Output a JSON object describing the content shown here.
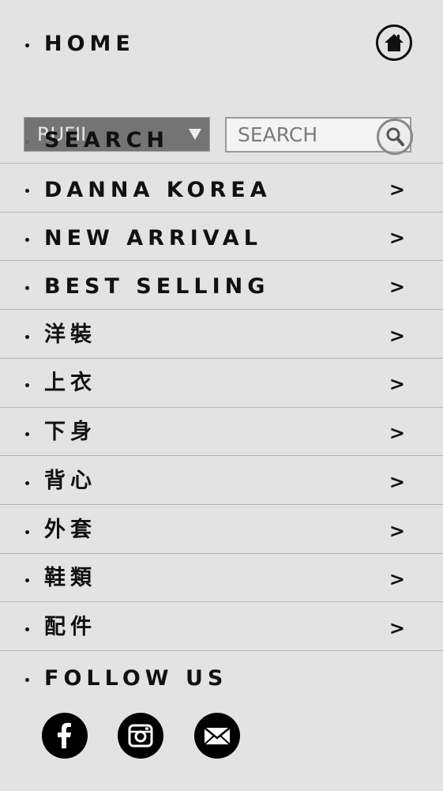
{
  "header": {
    "home_label": "HOME"
  },
  "search": {
    "label": "SEARCH",
    "currency_value": "RUFII",
    "placeholder": "SEARCH"
  },
  "menu": {
    "items": [
      {
        "label": "DANNA KOREA",
        "arrow": ">"
      },
      {
        "label": "NEW ARRIVAL",
        "arrow": ">"
      },
      {
        "label": "BEST SELLING",
        "arrow": ">"
      },
      {
        "label": "洋裝",
        "arrow": ">"
      },
      {
        "label": "上衣",
        "arrow": ">"
      },
      {
        "label": "下身",
        "arrow": ">"
      },
      {
        "label": "背心",
        "arrow": ">"
      },
      {
        "label": "外套",
        "arrow": ">"
      },
      {
        "label": "鞋類",
        "arrow": ">"
      },
      {
        "label": "配件",
        "arrow": ">"
      }
    ]
  },
  "follow": {
    "label": "FOLLOW US",
    "icons": [
      "facebook-icon",
      "instagram-icon",
      "email-icon"
    ]
  }
}
